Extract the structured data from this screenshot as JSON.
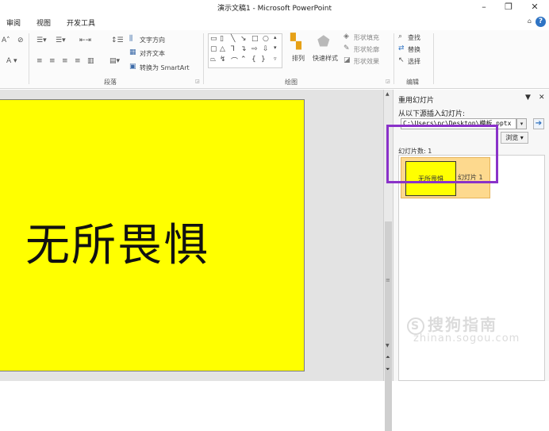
{
  "window": {
    "title": "演示文稿1 - Microsoft PowerPoint",
    "minimize": "–",
    "restore": "❐",
    "close": "✕"
  },
  "menu": {
    "tabs": [
      "审阅",
      "视图",
      "开发工具"
    ],
    "collapse": "⌂",
    "help": "?"
  },
  "ribbon": {
    "paragraph": {
      "text_direction": "文字方向",
      "align_text": "对齐文本",
      "smartart": "转换为 SmartArt",
      "group_label": "段落"
    },
    "drawing": {
      "arrange": "排列",
      "quick_styles": "快速样式",
      "shape_fill": "形状填充",
      "shape_outline": "形状轮廓",
      "shape_effects": "形状效果",
      "group_label": "绘图"
    },
    "editing": {
      "find": "查找",
      "replace": "替换",
      "select": "选择",
      "group_label": "编辑"
    }
  },
  "slide": {
    "text": "无所畏惧",
    "background_color": "#ffff00"
  },
  "pane": {
    "title": "重用幻灯片",
    "insert_from_label": "从以下源插入幻灯片:",
    "path_value": "C:\\Users\\pc\\Desktop\\模板.pptx",
    "browse": "浏览",
    "slide_count": "幻灯片数: 1",
    "items": [
      {
        "thumb_text": "无所畏惧",
        "name": "幻灯片 1"
      }
    ],
    "highlight_color": "#8a32c9"
  },
  "watermark": {
    "brand": "搜狗指南",
    "url": "zhinan.sogou.com"
  }
}
